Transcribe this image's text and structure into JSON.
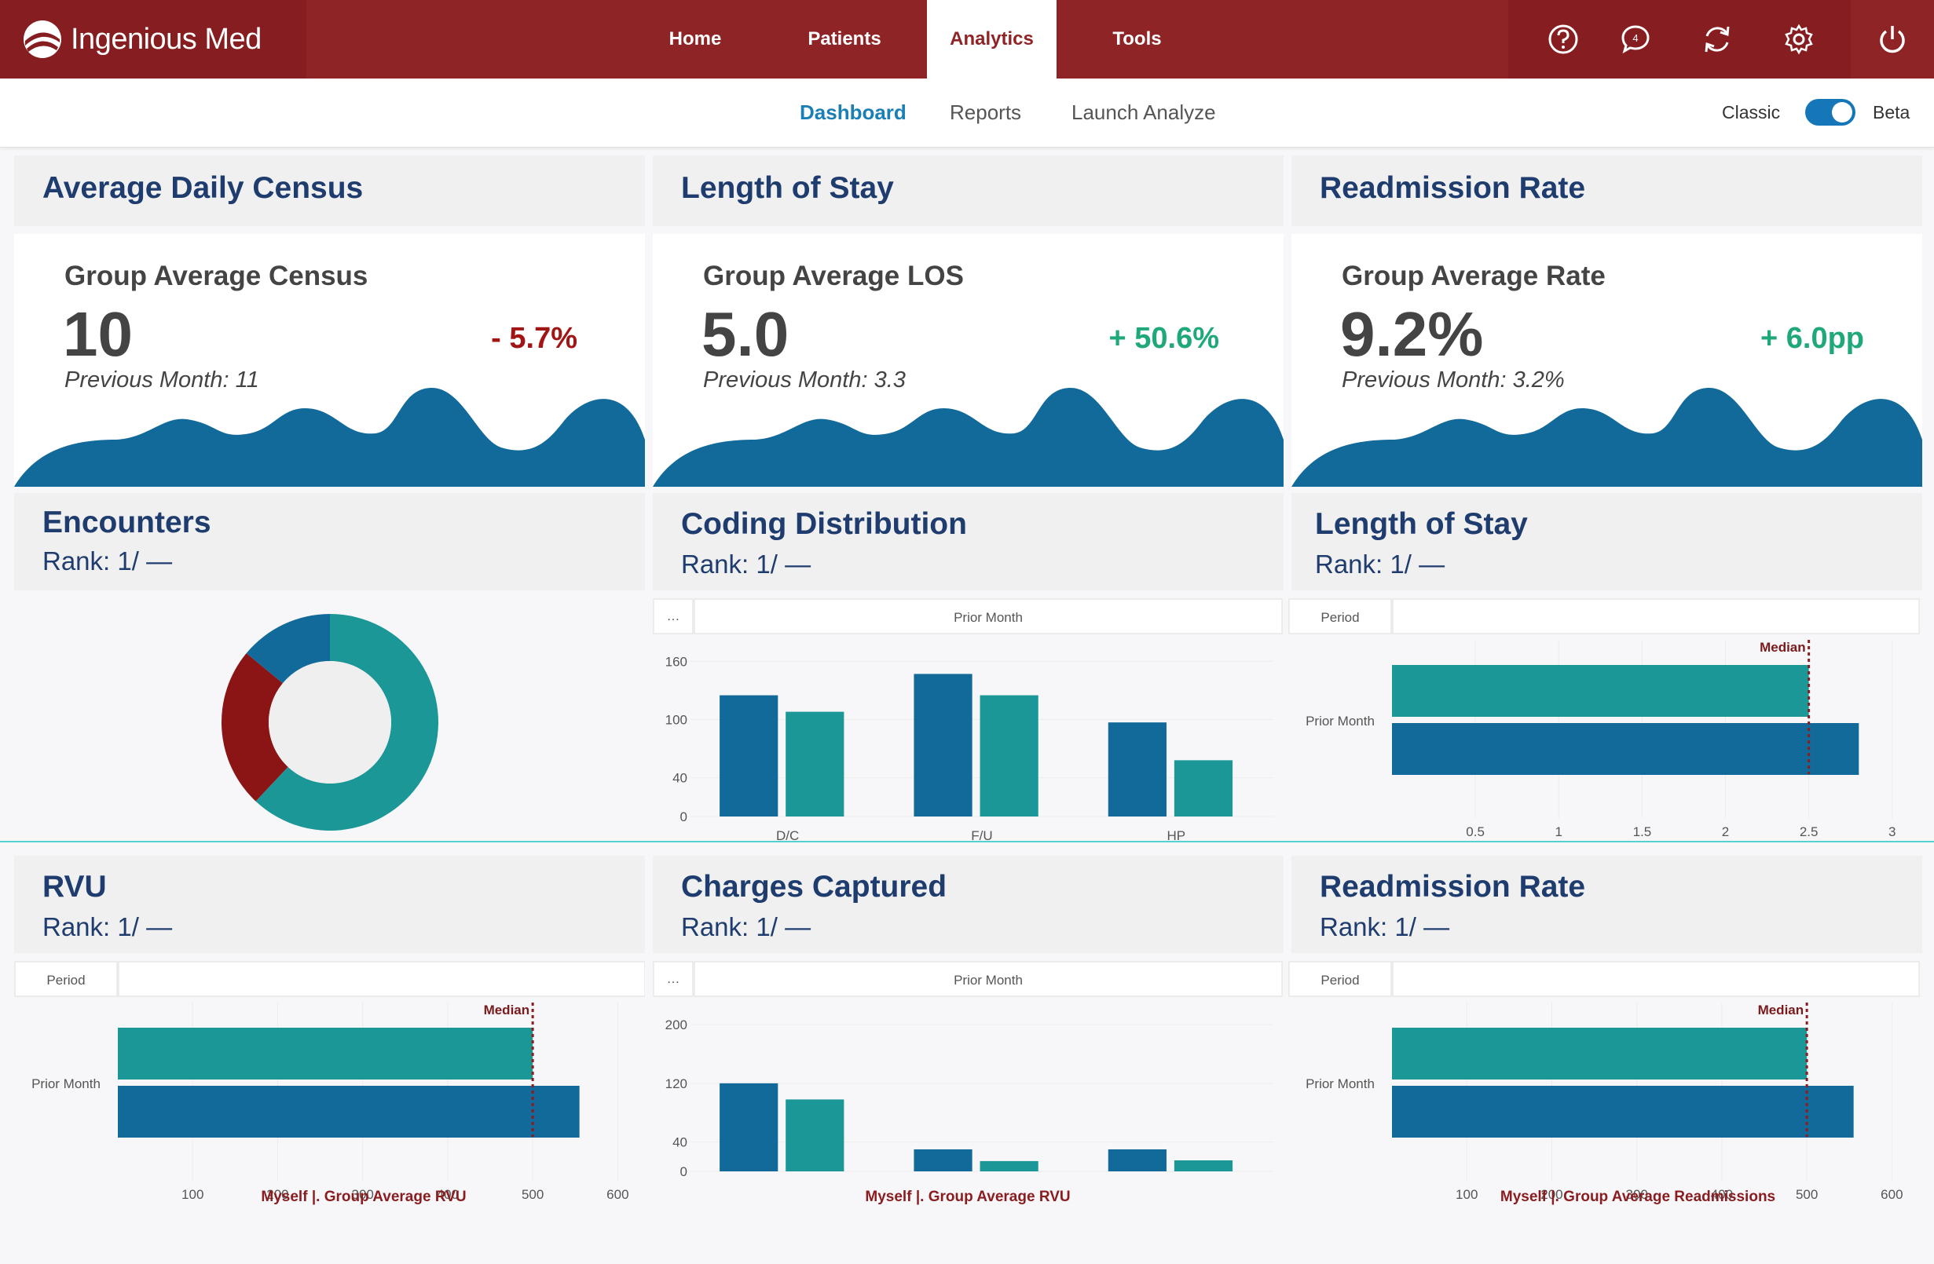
{
  "brand": {
    "name": "Ingenious Med"
  },
  "nav": {
    "tabs": [
      {
        "label": "Home"
      },
      {
        "label": "Patients"
      },
      {
        "label": "Analytics"
      },
      {
        "label": "Tools"
      }
    ],
    "active": "Analytics",
    "notification_count": "4"
  },
  "icons": [
    "help-icon",
    "chat-icon",
    "refresh-icon",
    "gear-icon",
    "power-icon"
  ],
  "subnav": {
    "tabs": [
      {
        "label": "Dashboard"
      },
      {
        "label": "Reports"
      },
      {
        "label": "Launch Analyze"
      }
    ],
    "active": "Dashboard",
    "toggle_left": "Classic",
    "toggle_right": "Beta",
    "toggle_on": true
  },
  "colors": {
    "brand": "#8f2426",
    "navy": "#1f3c6e",
    "blue": "#126a9a",
    "teal": "#1a9796",
    "red": "#8b1414",
    "green": "#1fa87a"
  },
  "kpis": [
    {
      "title": "Average Daily Census",
      "label": "Group Average Census",
      "value": "10",
      "delta": "- 5.7%",
      "delta_color": "#a11515",
      "previous": "Previous Month: 11"
    },
    {
      "title": "Length of Stay",
      "label": "Group Average LOS",
      "value": "5.0",
      "delta": "+ 50.6%",
      "delta_color": "#1fa87a",
      "previous": "Previous Month: 3.3"
    },
    {
      "title": "Readmission Rate",
      "label": "Group Average Rate",
      "value": "9.2%",
      "delta": "+ 6.0pp",
      "delta_color": "#1fa87a",
      "previous": "Previous Month: 3.2%"
    }
  ],
  "panels": [
    {
      "title": "Encounters",
      "rank": "Rank: 1/ —"
    },
    {
      "title": "Coding Distribution",
      "rank": "Rank: 1/ —"
    },
    {
      "title": "Length of Stay",
      "rank": "Rank: 1/ —"
    },
    {
      "title": "RVU",
      "rank": "Rank: 1/ —"
    },
    {
      "title": "Charges Captured",
      "rank": "Rank: 1/ —"
    },
    {
      "title": "Readmission Rate",
      "rank": "Rank: 1/ —"
    }
  ],
  "chart_data": [
    {
      "type": "pie",
      "subtype": "donut",
      "title": "Encounters",
      "slices": [
        {
          "value": 62,
          "color": "#1a9796"
        },
        {
          "value": 24,
          "color": "#8b1414"
        },
        {
          "value": 14,
          "color": "#126a9a"
        }
      ]
    },
    {
      "type": "bar",
      "title": "Coding Distribution",
      "header": "Prior Month",
      "header_corner": "…",
      "categories": [
        "D/C",
        "F/U",
        "HP"
      ],
      "series": [
        {
          "color": "#126a9a",
          "values": [
            125,
            147,
            97
          ]
        },
        {
          "color": "#1a9796",
          "values": [
            108,
            125,
            58
          ]
        }
      ],
      "yticks": [
        0,
        40,
        100,
        160
      ],
      "ylim": [
        0,
        170
      ]
    },
    {
      "type": "bar",
      "orientation": "horizontal",
      "title": "Length of Stay",
      "header": "Period",
      "category": "Prior Month",
      "series": [
        {
          "color": "#1a9796",
          "value": 2.5
        },
        {
          "color": "#126a9a",
          "value": 2.8
        }
      ],
      "median": 2.5,
      "median_label": "Median",
      "xticks": [
        0.5,
        1.0,
        1.5,
        2.0,
        2.5,
        3.0
      ],
      "xlim": [
        0.0,
        3.1
      ]
    },
    {
      "type": "bar",
      "orientation": "horizontal",
      "title": "RVU",
      "header": "Period",
      "category": "Prior Month",
      "series": [
        {
          "color": "#1a9796",
          "value": 500
        },
        {
          "color": "#126a9a",
          "value": 555
        }
      ],
      "median": 500,
      "median_label": "Median",
      "xticks": [
        100,
        200,
        300,
        400,
        500,
        600
      ],
      "xlim": [
        12,
        620
      ],
      "legend": "Myself  |. Group Average RVU"
    },
    {
      "type": "bar",
      "title": "Charges Captured",
      "header": "Prior Month",
      "header_corner": "…",
      "categories": [
        "",
        "",
        ""
      ],
      "series": [
        {
          "color": "#126a9a",
          "values": [
            120,
            30,
            30
          ]
        },
        {
          "color": "#1a9796",
          "values": [
            98,
            14,
            15
          ]
        }
      ],
      "yticks": [
        0,
        40,
        120,
        200
      ],
      "ylim": [
        0,
        214
      ],
      "legend": "Myself  |. Group Average RVU"
    },
    {
      "type": "bar",
      "orientation": "horizontal",
      "title": "Readmission Rate",
      "header": "Period",
      "category": "Prior Month",
      "series": [
        {
          "color": "#1a9796",
          "value": 500
        },
        {
          "color": "#126a9a",
          "value": 555
        }
      ],
      "median": 500,
      "median_label": "Median",
      "xticks": [
        100,
        200,
        300,
        400,
        500,
        600
      ],
      "xlim": [
        12,
        620
      ],
      "legend": "Myself  |. Group Average Readmissions"
    }
  ]
}
